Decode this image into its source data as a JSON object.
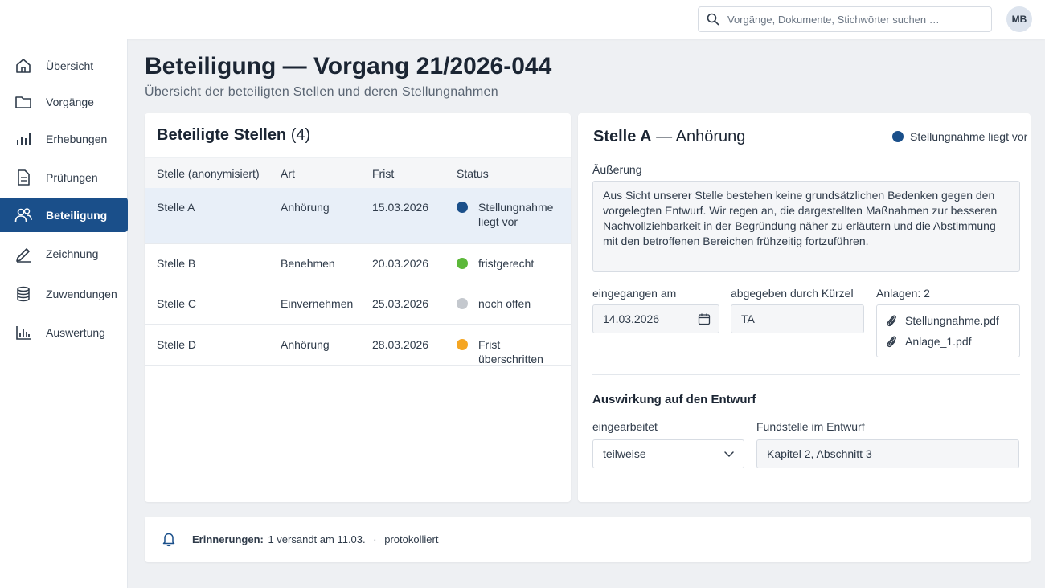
{
  "search": {
    "placeholder": "Vorgänge, Dokumente, Stichwörter suchen …"
  },
  "user": {
    "initials": "MB"
  },
  "sidebar": {
    "items": [
      {
        "label": "Übersicht",
        "icon": "home-icon",
        "active": false
      },
      {
        "label": "Vorgänge",
        "icon": "folder-icon",
        "active": false
      },
      {
        "label": "Erhebungen",
        "icon": "bar-chart-icon",
        "active": false
      },
      {
        "label": "Prüfungen",
        "icon": "document-icon",
        "active": false
      },
      {
        "label": "Beteiligung",
        "icon": "users-icon",
        "active": true
      },
      {
        "label": "Zeichnung",
        "icon": "pen-icon",
        "active": false
      },
      {
        "label": "Zuwendungen",
        "icon": "database-icon",
        "active": false
      },
      {
        "label": "Auswertung",
        "icon": "analytics-icon",
        "active": false
      }
    ]
  },
  "page": {
    "title": "Beteiligung — Vorgang 21/2026-044",
    "subtitle": "Übersicht der beteiligten Stellen und deren Stellungnahmen"
  },
  "list": {
    "title": "Beteiligte Stellen",
    "count": "(4)",
    "headers": [
      "Stelle (anonymisiert)",
      "Art",
      "Frist",
      "Status"
    ],
    "rows": [
      {
        "stelle": "Stelle A",
        "art": "Anhörung",
        "frist": "15.03.2026",
        "status": "Stellungnahme liegt vor",
        "color": "#1a4f8a"
      },
      {
        "stelle": "Stelle B",
        "art": "Benehmen",
        "frist": "20.03.2026",
        "status": "fristgerecht",
        "color": "#5cb83a"
      },
      {
        "stelle": "Stelle C",
        "art": "Einvernehmen",
        "frist": "25.03.2026",
        "status": "noch offen",
        "color": "#c4c8ce"
      },
      {
        "stelle": "Stelle D",
        "art": "Anhörung",
        "frist": "28.03.2026",
        "status": "Frist überschritten",
        "color": "#f5a623"
      }
    ]
  },
  "detail": {
    "title_bold": "Stelle A",
    "title_rest": " — Anhörung",
    "status": "Stellungnahme liegt vor",
    "status_color": "#1a4f8a",
    "aeusserung_label": "Äußerung",
    "aeusserung_text": "Aus Sicht unserer Stelle bestehen keine grundsätzlichen Bedenken gegen den vorgelegten Entwurf. Wir regen an, die dargestellten Maßnahmen zur besseren Nachvollziehbarkeit in der Begründung näher zu erläutern und die Abstimmung mit den betroffenen Bereichen frühzeitig fortzuführen.",
    "eingegangen_label": "eingegangen am",
    "eingegangen_value": "14.03.2026",
    "kuerzel_label": "abgegeben durch Kürzel",
    "kuerzel_value": "TA",
    "anlagen_label": "Anlagen: 2",
    "attachments": [
      "Stellungnahme.pdf",
      "Anlage_1.pdf"
    ],
    "section_title": "Auswirkung auf den Entwurf",
    "eingearbeitet_label": "eingearbeitet",
    "eingearbeitet_value": "teilweise",
    "fundstelle_label": "Fundstelle im Entwurf",
    "fundstelle_value": "Kapitel 2, Abschnitt 3"
  },
  "reminders": {
    "label": "Erinnerungen:",
    "text": "1 versandt am 11.03.",
    "separator": "·",
    "logged": "protokolliert"
  }
}
